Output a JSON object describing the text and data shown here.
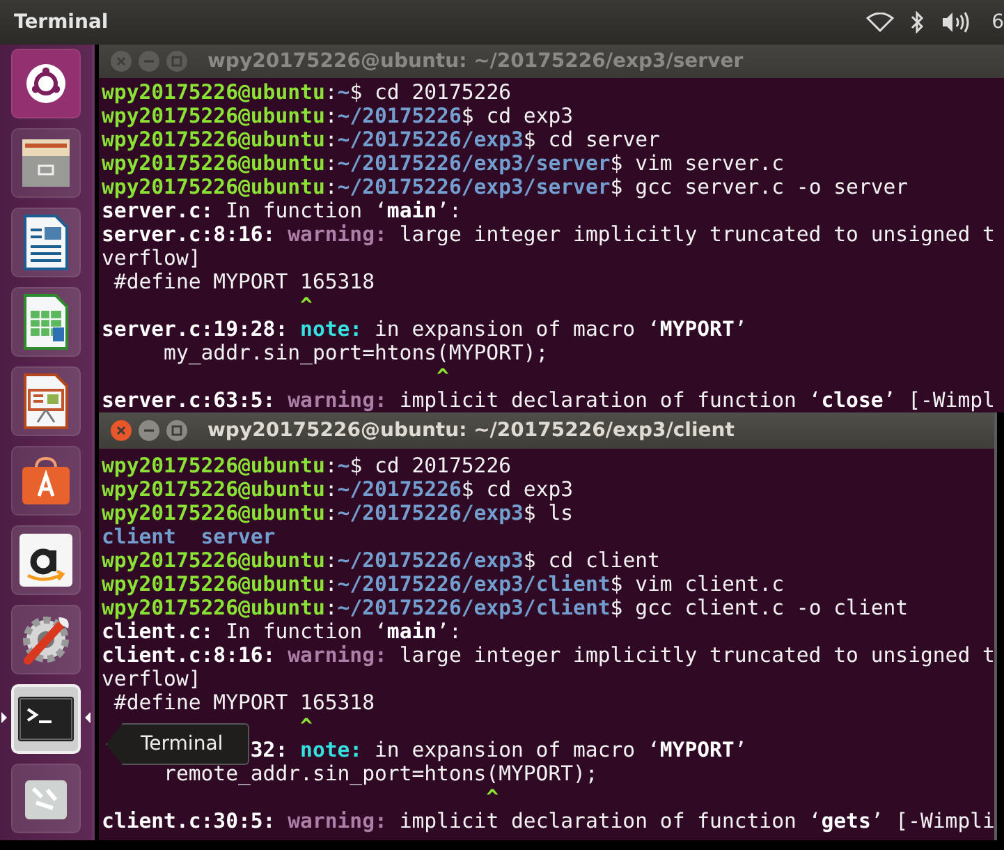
{
  "top_bar": {
    "title": "Terminal",
    "tray": [
      {
        "kind": "wifi"
      },
      {
        "kind": "bluetooth"
      },
      {
        "kind": "volume"
      }
    ],
    "clock": "6"
  },
  "launcher": [
    {
      "kind": "ubuntu",
      "active": false
    },
    {
      "kind": "files",
      "active": false
    },
    {
      "kind": "writer",
      "active": false
    },
    {
      "kind": "calc",
      "active": false
    },
    {
      "kind": "impress",
      "active": false
    },
    {
      "kind": "store",
      "active": false
    },
    {
      "kind": "amazon",
      "active": false
    },
    {
      "kind": "settings",
      "active": false
    },
    {
      "kind": "terminal",
      "active": true
    },
    {
      "kind": "trash",
      "active": false
    }
  ],
  "tooltip": "Terminal",
  "windows": [
    {
      "title": "wpy20175226@ubuntu: ~/20175226/exp3/server",
      "focused": false,
      "lines": [
        [
          {
            "kind": "user",
            "text": "wpy20175226@ubuntu"
          },
          {
            "kind": "plain",
            "text": ":"
          },
          {
            "kind": "path",
            "text": "~"
          },
          {
            "kind": "plain",
            "text": "$ cd 20175226"
          }
        ],
        [
          {
            "kind": "user",
            "text": "wpy20175226@ubuntu"
          },
          {
            "kind": "plain",
            "text": ":"
          },
          {
            "kind": "path",
            "text": "~/20175226"
          },
          {
            "kind": "plain",
            "text": "$ cd exp3"
          }
        ],
        [
          {
            "kind": "user",
            "text": "wpy20175226@ubuntu"
          },
          {
            "kind": "plain",
            "text": ":"
          },
          {
            "kind": "path",
            "text": "~/20175226/exp3"
          },
          {
            "kind": "plain",
            "text": "$ cd server"
          }
        ],
        [
          {
            "kind": "user",
            "text": "wpy20175226@ubuntu"
          },
          {
            "kind": "plain",
            "text": ":"
          },
          {
            "kind": "path",
            "text": "~/20175226/exp3/server"
          },
          {
            "kind": "plain",
            "text": "$ vim server.c"
          }
        ],
        [
          {
            "kind": "user",
            "text": "wpy20175226@ubuntu"
          },
          {
            "kind": "plain",
            "text": ":"
          },
          {
            "kind": "path",
            "text": "~/20175226/exp3/server"
          },
          {
            "kind": "plain",
            "text": "$ gcc server.c -o server"
          }
        ],
        [
          {
            "kind": "bold",
            "text": "server.c:"
          },
          {
            "kind": "plain",
            "text": " In function ‘"
          },
          {
            "kind": "bold",
            "text": "main"
          },
          {
            "kind": "plain",
            "text": "’:"
          }
        ],
        [
          {
            "kind": "bold",
            "text": "server.c:8:16: "
          },
          {
            "kind": "warning",
            "text": "warning:"
          },
          {
            "kind": "plain",
            "text": " large integer implicitly truncated to unsigned t"
          }
        ],
        [
          {
            "kind": "plain",
            "text": "verflow]"
          }
        ],
        [
          {
            "kind": "plain",
            "text": " #define MYPORT 165318"
          }
        ],
        [
          {
            "kind": "caret",
            "text": "                ^"
          }
        ],
        [
          {
            "kind": "bold",
            "text": "server.c:19:28: "
          },
          {
            "kind": "note",
            "text": "note:"
          },
          {
            "kind": "plain",
            "text": " in expansion of macro ‘"
          },
          {
            "kind": "bold",
            "text": "MYPORT"
          },
          {
            "kind": "plain",
            "text": "’"
          }
        ],
        [
          {
            "kind": "plain",
            "text": "     my_addr.sin_port=htons(MYPORT);"
          }
        ],
        [
          {
            "kind": "caret",
            "text": "                           ^"
          }
        ],
        [
          {
            "kind": "bold",
            "text": "server.c:63:5: "
          },
          {
            "kind": "warning",
            "text": "warning:"
          },
          {
            "kind": "plain",
            "text": " implicit declaration of function ‘"
          },
          {
            "kind": "bold",
            "text": "close"
          },
          {
            "kind": "plain",
            "text": "’ [-Wimpl"
          }
        ]
      ]
    },
    {
      "title": "wpy20175226@ubuntu: ~/20175226/exp3/client",
      "focused": true,
      "lines": [
        [
          {
            "kind": "user",
            "text": "wpy20175226@ubuntu"
          },
          {
            "kind": "plain",
            "text": ":"
          },
          {
            "kind": "path",
            "text": "~"
          },
          {
            "kind": "plain",
            "text": "$ cd 20175226"
          }
        ],
        [
          {
            "kind": "user",
            "text": "wpy20175226@ubuntu"
          },
          {
            "kind": "plain",
            "text": ":"
          },
          {
            "kind": "path",
            "text": "~/20175226"
          },
          {
            "kind": "plain",
            "text": "$ cd exp3"
          }
        ],
        [
          {
            "kind": "user",
            "text": "wpy20175226@ubuntu"
          },
          {
            "kind": "plain",
            "text": ":"
          },
          {
            "kind": "path",
            "text": "~/20175226/exp3"
          },
          {
            "kind": "plain",
            "text": "$ ls"
          }
        ],
        [
          {
            "kind": "dir",
            "text": "client  server"
          }
        ],
        [
          {
            "kind": "user",
            "text": "wpy20175226@ubuntu"
          },
          {
            "kind": "plain",
            "text": ":"
          },
          {
            "kind": "path",
            "text": "~/20175226/exp3"
          },
          {
            "kind": "plain",
            "text": "$ cd client"
          }
        ],
        [
          {
            "kind": "user",
            "text": "wpy20175226@ubuntu"
          },
          {
            "kind": "plain",
            "text": ":"
          },
          {
            "kind": "path",
            "text": "~/20175226/exp3/client"
          },
          {
            "kind": "plain",
            "text": "$ vim client.c"
          }
        ],
        [
          {
            "kind": "user",
            "text": "wpy20175226@ubuntu"
          },
          {
            "kind": "plain",
            "text": ":"
          },
          {
            "kind": "path",
            "text": "~/20175226/exp3/client"
          },
          {
            "kind": "plain",
            "text": "$ gcc client.c -o client"
          }
        ],
        [
          {
            "kind": "bold",
            "text": "client.c:"
          },
          {
            "kind": "plain",
            "text": " In function ‘"
          },
          {
            "kind": "bold",
            "text": "main"
          },
          {
            "kind": "plain",
            "text": "’:"
          }
        ],
        [
          {
            "kind": "bold",
            "text": "client.c:8:16: "
          },
          {
            "kind": "warning",
            "text": "warning:"
          },
          {
            "kind": "plain",
            "text": " large integer implicitly truncated to unsigned t"
          }
        ],
        [
          {
            "kind": "plain",
            "text": "verflow]"
          }
        ],
        [
          {
            "kind": "plain",
            "text": " #define MYPORT 165318"
          }
        ],
        [
          {
            "kind": "caret",
            "text": "                ^"
          }
        ],
        [
          {
            "kind": "covered"
          },
          {
            "kind": "bold",
            "text": "32: "
          },
          {
            "kind": "note",
            "text": "note:"
          },
          {
            "kind": "plain",
            "text": " in expansion of macro ‘"
          },
          {
            "kind": "bold",
            "text": "MYPORT"
          },
          {
            "kind": "plain",
            "text": "’"
          }
        ],
        [
          {
            "kind": "plain",
            "text": "     remote_addr.sin_port=htons(MYPORT);"
          }
        ],
        [
          {
            "kind": "caret",
            "text": "                               ^"
          }
        ],
        [
          {
            "kind": "bold",
            "text": "client.c:30:5: "
          },
          {
            "kind": "warning",
            "text": "warning:"
          },
          {
            "kind": "plain",
            "text": " implicit declaration of function ‘"
          },
          {
            "kind": "bold",
            "text": "gets"
          },
          {
            "kind": "plain",
            "text": "’ [-Wimpli"
          }
        ]
      ]
    }
  ]
}
